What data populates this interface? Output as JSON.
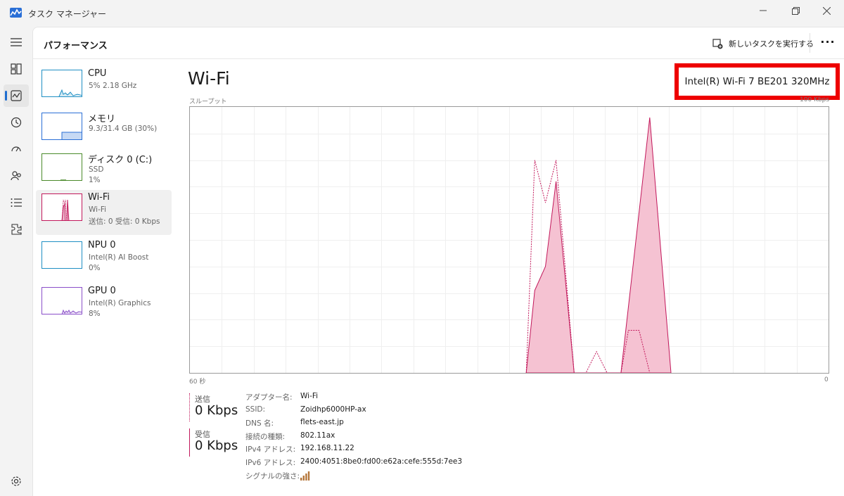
{
  "window": {
    "title": "タスク マネージャー"
  },
  "header": {
    "page_title": "パフォーマンス",
    "run_task_label": "新しいタスクを実行する",
    "more_label": "···"
  },
  "nav": [
    {
      "icon": "hamburger-menu-icon"
    },
    {
      "icon": "processes-icon"
    },
    {
      "icon": "performance-icon",
      "active": true
    },
    {
      "icon": "app-history-icon"
    },
    {
      "icon": "startup-apps-icon"
    },
    {
      "icon": "users-icon"
    },
    {
      "icon": "details-icon"
    },
    {
      "icon": "services-icon"
    },
    {
      "icon": "settings-icon"
    }
  ],
  "devices": [
    {
      "name": "CPU",
      "sub1": "5%  2.18 GHz",
      "sub2": "",
      "sub3": "",
      "thumb_color": "#1f8fc4",
      "level": 0.05
    },
    {
      "name": "メモリ",
      "sub1": "9.3/31.4 GB (30%)",
      "sub2": "",
      "sub3": "",
      "thumb_color": "#2a6fd6",
      "level": 0.3
    },
    {
      "name": "ディスク 0 (C:)",
      "sub1": "SSD",
      "sub2": "1%",
      "sub3": "",
      "thumb_color": "#4a8a2a",
      "level": 0.01
    },
    {
      "name": "Wi-Fi",
      "sub1": "Wi-Fi",
      "sub2": "送信: 0  受信: 0 Kbps",
      "sub3": "",
      "thumb_color": "#c2185b",
      "level": 0,
      "selected": true
    },
    {
      "name": "NPU 0",
      "sub1": "Intel(R) AI Boost",
      "sub2": "0%",
      "sub3": "",
      "thumb_color": "#1f8fc4",
      "level": 0
    },
    {
      "name": "GPU 0",
      "sub1": "Intel(R) Graphics",
      "sub2": "8%",
      "sub3": "",
      "thumb_color": "#8a4fc9",
      "level": 0.08
    }
  ],
  "detail": {
    "title": "Wi-Fi",
    "adapter_name": "Intel(R) Wi-Fi 7 BE201 320MHz",
    "graph_label": "スループット",
    "graph_max": "100 Kbps",
    "axis_left": "60 秒",
    "axis_right": "0",
    "send_label": "送信",
    "send_value": "0 Kbps",
    "recv_label": "受信",
    "recv_value": "0 Kbps",
    "properties": [
      {
        "label": "アダプター名:",
        "value": "Wi-Fi"
      },
      {
        "label": "SSID:",
        "value": "Zoidhp6000HP-ax"
      },
      {
        "label": "DNS 名:",
        "value": "flets-east.jp"
      },
      {
        "label": "接続の種類:",
        "value": "802.11ax"
      },
      {
        "label": "IPv4 アドレス:",
        "value": "192.168.11.22"
      },
      {
        "label": "IPv6 アドレス:",
        "value": "2400:4051:8be0:fd00:e62a:cefe:555d:7ee3"
      },
      {
        "label": "シグナルの強さ:",
        "value": ""
      }
    ],
    "signal_bars": 4
  },
  "chart_data": {
    "type": "area",
    "ylim": [
      0,
      100
    ],
    "xlim": [
      60,
      0
    ],
    "series": [
      {
        "style": "filled",
        "color": "#c2185b",
        "points": [
          [
            28.4,
            0
          ],
          [
            27.6,
            31
          ],
          [
            26.6,
            40
          ],
          [
            25.6,
            72
          ],
          [
            23.9,
            0
          ],
          [
            20.2,
            0
          ],
          [
            19.5,
            0
          ],
          [
            16.8,
            96
          ],
          [
            14.8,
            0
          ]
        ]
      },
      {
        "style": "dotted",
        "color": "#c2185b",
        "points": [
          [
            28.4,
            0
          ],
          [
            27.6,
            80
          ],
          [
            26.6,
            64
          ],
          [
            25.6,
            80
          ],
          [
            23.9,
            0
          ],
          [
            22.8,
            0
          ],
          [
            21.8,
            8
          ],
          [
            20.8,
            0
          ],
          [
            20.2,
            0
          ],
          [
            19.5,
            0
          ],
          [
            18.8,
            16
          ],
          [
            17.8,
            16
          ],
          [
            16.8,
            0
          ]
        ]
      }
    ]
  }
}
